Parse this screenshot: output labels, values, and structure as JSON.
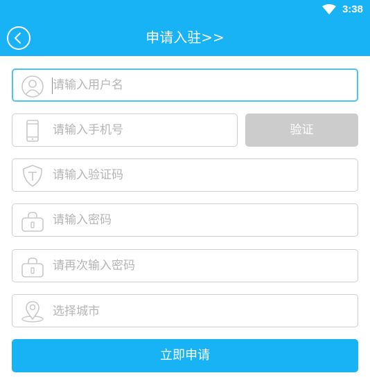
{
  "status_bar": {
    "time": "3:38",
    "wifi_icon": "wifi-icon"
  },
  "header": {
    "title": "申请入驻>>",
    "back_icon": "back-circle-icon"
  },
  "form": {
    "username": {
      "placeholder": "请输入用户名",
      "icon": "user-icon"
    },
    "phone": {
      "placeholder": "请输入手机号",
      "icon": "phone-icon"
    },
    "verify_button_label": "验证",
    "verify_code": {
      "placeholder": "请输入验证码",
      "icon": "shield-icon"
    },
    "password": {
      "placeholder": "请输入密码",
      "icon": "lock-icon"
    },
    "password_confirm": {
      "placeholder": "请再次输入密码",
      "icon": "lock-icon"
    },
    "city": {
      "placeholder": "选择城市",
      "icon": "location-pin-icon"
    },
    "submit_label": "立即申请"
  },
  "colors": {
    "primary": "#17b3f5",
    "focus_border": "#4dc3f5",
    "disabled": "#cccccc",
    "icon": "#c8c8c8"
  }
}
